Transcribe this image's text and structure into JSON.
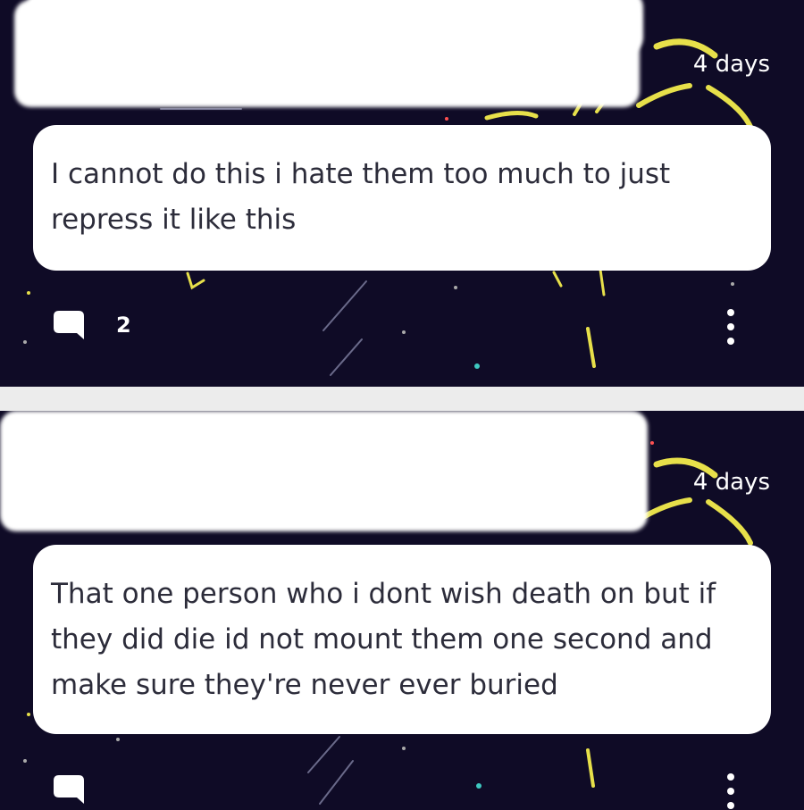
{
  "posts": [
    {
      "timestamp": "4 days",
      "text": "I cannot do this i hate them too much to just repress it like this",
      "comment_count": "2",
      "comment_icon": "comment-bubble-icon",
      "more_icon": "more-vertical-icon"
    },
    {
      "timestamp": "4 days",
      "text": "That one person who i dont wish death on but if they did die id not mount them one second and make sure they're never ever buried",
      "comment_count": "",
      "comment_icon": "comment-bubble-icon",
      "more_icon": "more-vertical-icon"
    }
  ],
  "colors": {
    "background": "#0f0b26",
    "accent_yellow": "#e7e04a",
    "card": "#ffffff",
    "text": "#2c2c3a",
    "divider": "#ececec"
  }
}
